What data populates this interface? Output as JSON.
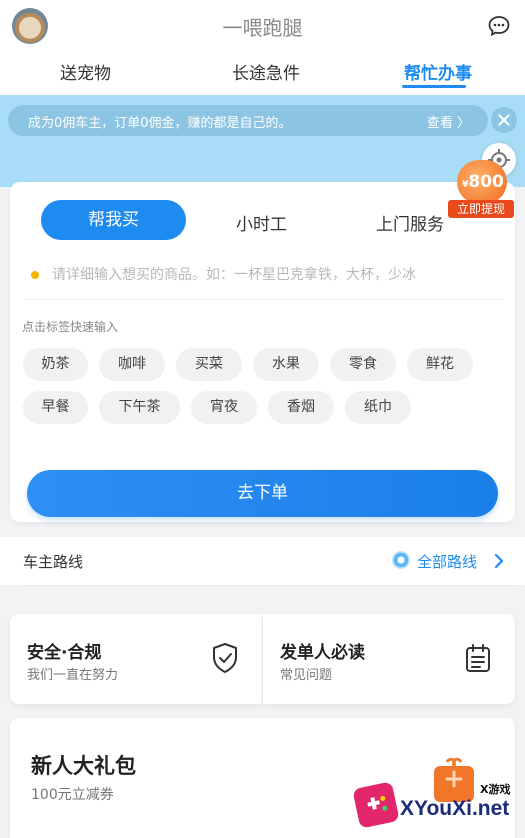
{
  "header": {
    "title": "一喂跑腿",
    "tabs": [
      {
        "label": "送宠物"
      },
      {
        "label": "长途急件"
      },
      {
        "label": "帮忙办事"
      }
    ]
  },
  "promo": {
    "text": "成为0佣车主，订单0佣金，赚的都是自己的。",
    "link": "查看 〉"
  },
  "badge": {
    "currency": "¥",
    "amount": "800",
    "ribbon": "立即提现"
  },
  "service": {
    "tabs": [
      {
        "label": "帮我买"
      },
      {
        "label": "小时工"
      },
      {
        "label": "上门服务"
      }
    ],
    "input_placeholder": "请详细输入想买的商品。如：一杯星巴克拿铁，大杯，少冰",
    "hint": "点击标签快速输入",
    "chips": [
      "奶茶",
      "咖啡",
      "买菜",
      "水果",
      "零食",
      "鲜花",
      "早餐",
      "下午茶",
      "宵夜",
      "香烟",
      "纸巾"
    ],
    "order_button": "去下单"
  },
  "route": {
    "title": "车主路线",
    "link": "全部路线"
  },
  "cards": {
    "safety": {
      "title": "安全·合规",
      "subtitle": "我们一直在努力"
    },
    "guide": {
      "title": "发单人必读",
      "subtitle": "常见问题"
    }
  },
  "gift": {
    "title": "新人大礼包",
    "subtitle": "100元立减券"
  },
  "watermark": {
    "top": "X游戏",
    "text": "XYouXi.net"
  },
  "colors": {
    "accent": "#1e8bf0",
    "banner": "#a9dcf6",
    "badge": "#f06a1e",
    "dot": "#f5b400"
  }
}
